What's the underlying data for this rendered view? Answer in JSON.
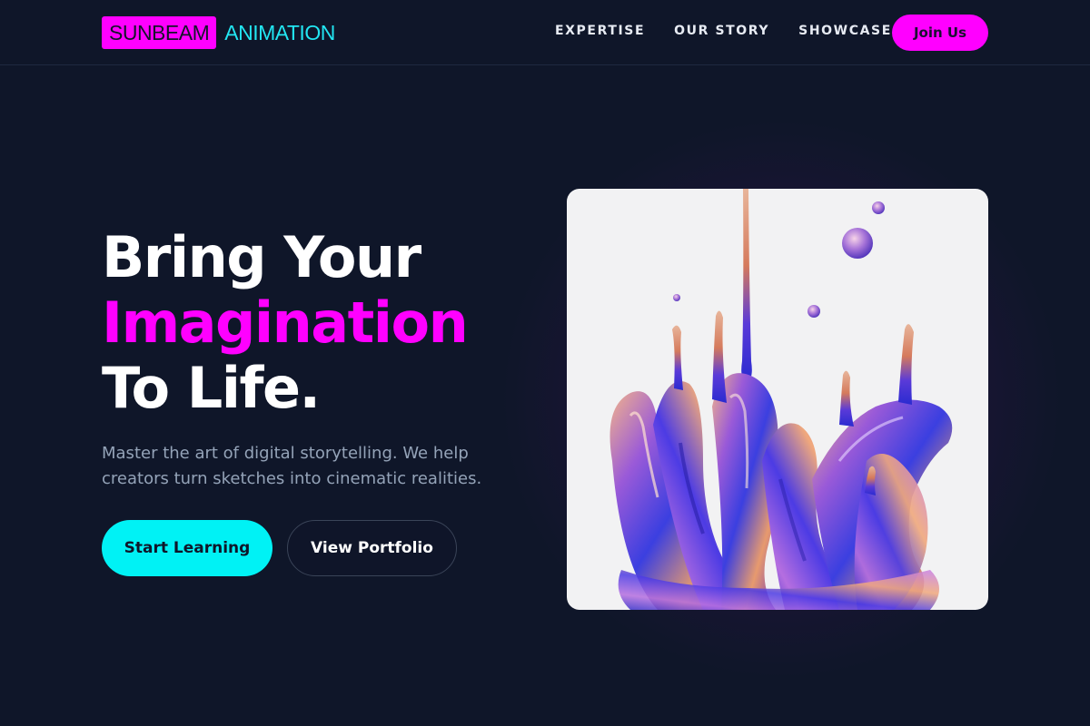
{
  "brand": {
    "box_text": "SUNBEAM",
    "text": "ANIMATION",
    "box_color": "#ff00ff",
    "text_color": "#22e6f2"
  },
  "nav": {
    "links": [
      {
        "label": "EXPERTISE"
      },
      {
        "label": "OUR STORY"
      },
      {
        "label": "SHOWCASE"
      }
    ],
    "cta_label": "Join Us"
  },
  "hero": {
    "title_line1": "Bring Your",
    "title_line2": "Imagination",
    "title_line3": "To Life.",
    "subtitle": "Master the art of digital storytelling. We help creators turn sketches into cinematic realities.",
    "primary_button": "Start Learning",
    "secondary_button": "View Portfolio",
    "image_subject": "iridescent-liquid-splash-illustration"
  },
  "colors": {
    "background": "#0f1629",
    "accent_magenta": "#ff00ff",
    "accent_cyan": "#00f2f5",
    "muted_text": "#94a3b8"
  }
}
